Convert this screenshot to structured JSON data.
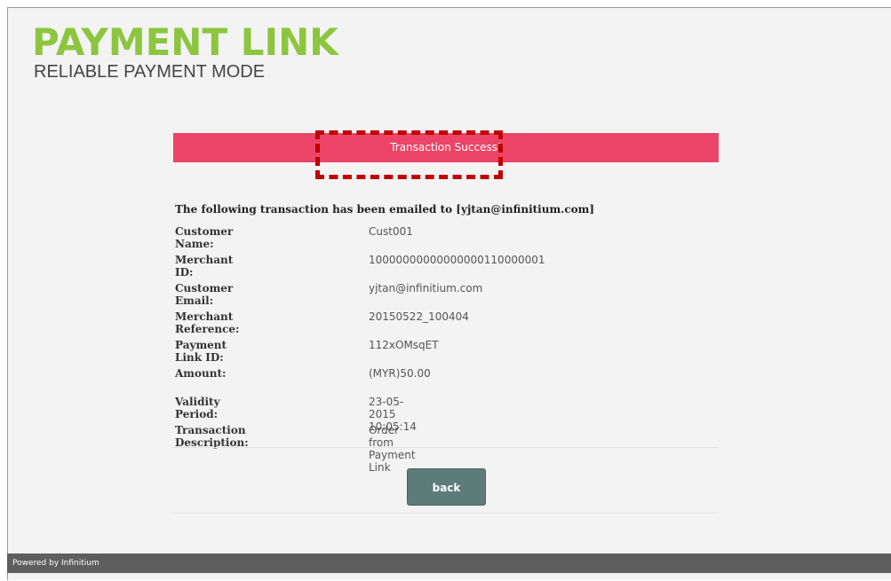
{
  "brand": {
    "title": "PAYMENT LINK",
    "subtitle": "RELIABLE PAYMENT MODE",
    "accent": "#8cc63f"
  },
  "banner": {
    "text": "Transaction Success!",
    "color": "#ec4567"
  },
  "notice": "The following transaction has been emailed to [yjtan@infinitium.com]",
  "details": [
    {
      "label": "Customer Name:",
      "value": "Cust001"
    },
    {
      "label": "Merchant ID:",
      "value": "10000000000000000110000001"
    },
    {
      "label": "Customer Email:",
      "value": "yjtan@infinitium.com"
    },
    {
      "label": "Merchant Reference:",
      "value": "20150522_100404"
    },
    {
      "label": "Payment Link ID:",
      "value": "112xOMsqET"
    },
    {
      "label": "Amount:",
      "value": "(MYR)50.00"
    },
    {
      "label": "Validity Period:",
      "value": "23-05-2015 10:05:14"
    },
    {
      "label": "Transaction Description:",
      "value": "Order from Payment Link"
    }
  ],
  "actions": {
    "back_label": "back"
  },
  "footer": {
    "text": "Powered by Infinitium"
  }
}
